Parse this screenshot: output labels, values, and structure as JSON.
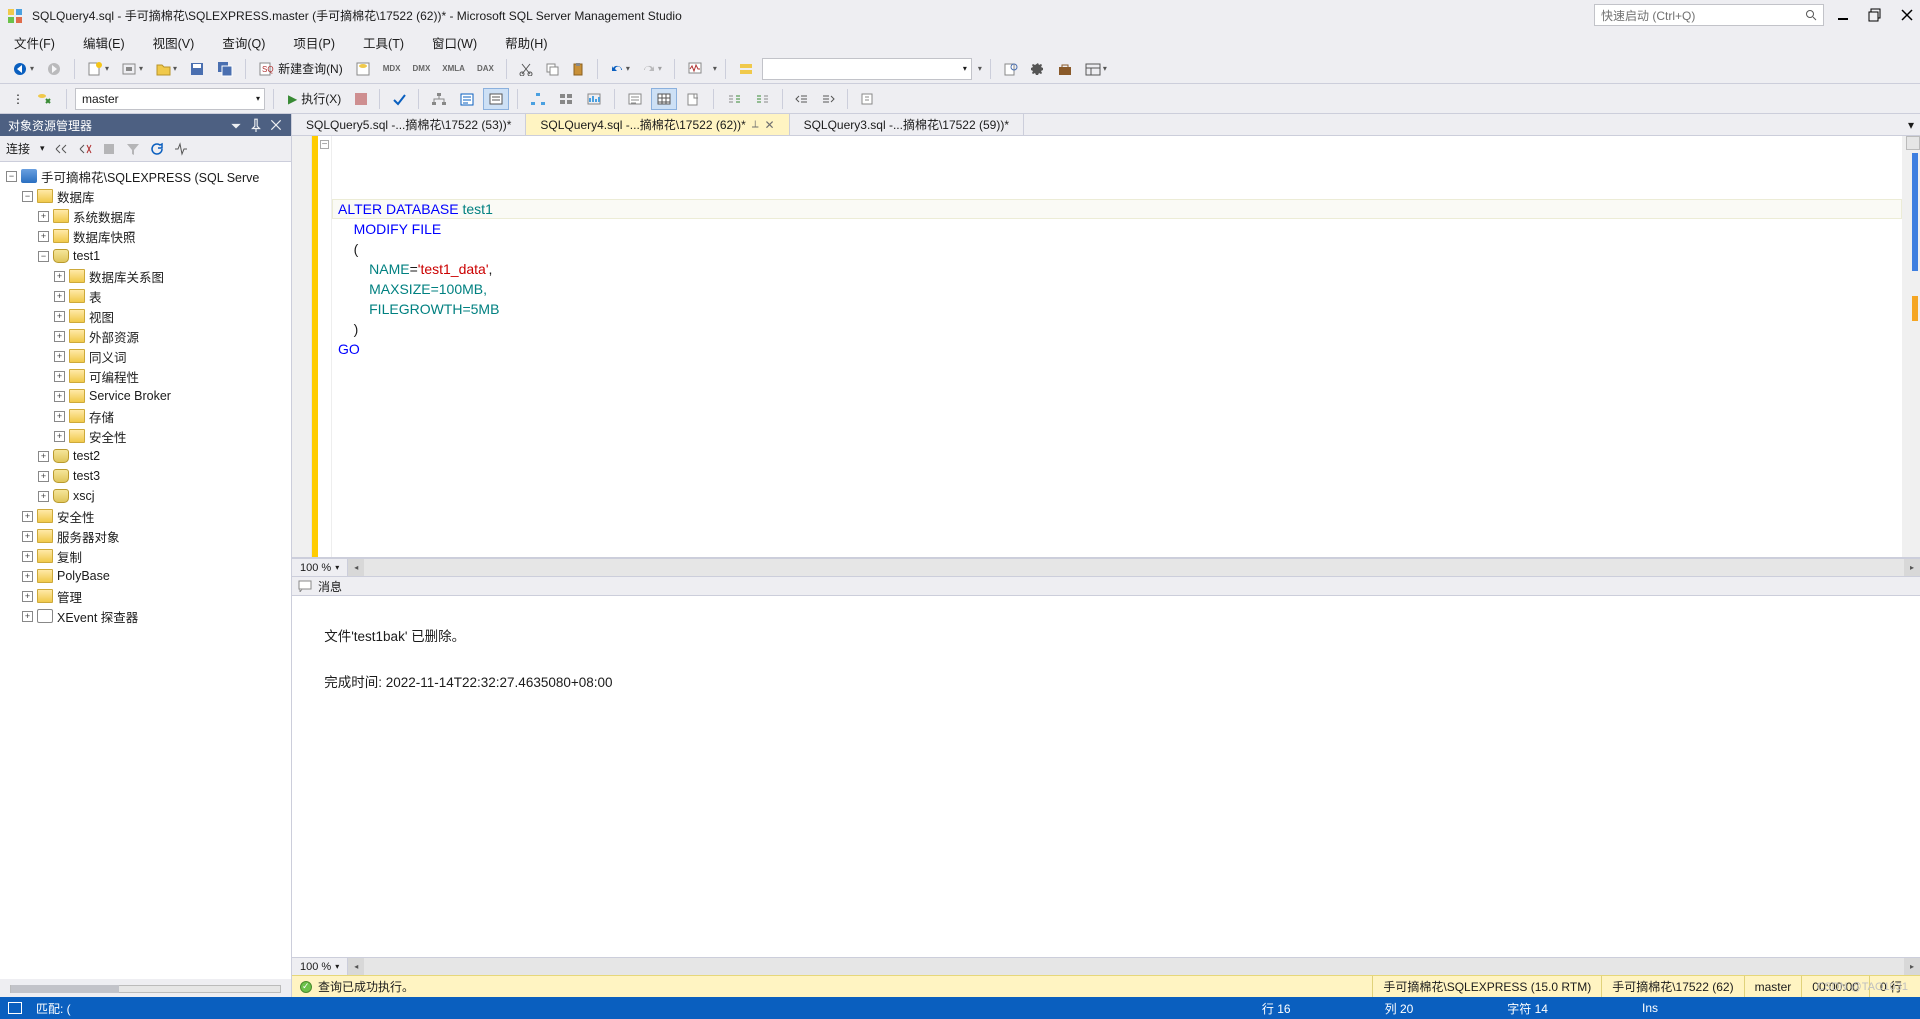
{
  "title": "SQLQuery4.sql - 手可摘棉花\\SQLEXPRESS.master (手可摘棉花\\17522 (62))* - Microsoft SQL Server Management Studio",
  "quick_launch": {
    "placeholder": "快速启动 (Ctrl+Q)"
  },
  "menu": [
    "文件(F)",
    "编辑(E)",
    "视图(V)",
    "查询(Q)",
    "项目(P)",
    "工具(T)",
    "窗口(W)",
    "帮助(H)"
  ],
  "toolbar1": {
    "new_query": "新建查询(N)",
    "xmla_labels": [
      "MDX",
      "DMX",
      "XMLA",
      "DAX"
    ]
  },
  "toolbar2": {
    "db_combo": "master",
    "execute": "执行(X)"
  },
  "object_explorer": {
    "title": "对象资源管理器",
    "connect_label": "连接",
    "root": "手可摘棉花\\SQLEXPRESS (SQL Serve",
    "nodes": [
      {
        "label": "数据库",
        "exp": true,
        "depth": 1,
        "icon": "folder",
        "children": [
          {
            "label": "系统数据库",
            "depth": 2,
            "icon": "folder"
          },
          {
            "label": "数据库快照",
            "depth": 2,
            "icon": "folder"
          },
          {
            "label": "test1",
            "exp": true,
            "depth": 2,
            "icon": "db",
            "children": [
              {
                "label": "数据库关系图",
                "depth": 3,
                "icon": "folder"
              },
              {
                "label": "表",
                "depth": 3,
                "icon": "folder"
              },
              {
                "label": "视图",
                "depth": 3,
                "icon": "folder"
              },
              {
                "label": "外部资源",
                "depth": 3,
                "icon": "folder"
              },
              {
                "label": "同义词",
                "depth": 3,
                "icon": "folder"
              },
              {
                "label": "可编程性",
                "depth": 3,
                "icon": "folder"
              },
              {
                "label": "Service Broker",
                "depth": 3,
                "icon": "folder"
              },
              {
                "label": "存储",
                "depth": 3,
                "icon": "folder"
              },
              {
                "label": "安全性",
                "depth": 3,
                "icon": "folder"
              }
            ]
          },
          {
            "label": "test2",
            "depth": 2,
            "icon": "db"
          },
          {
            "label": "test3",
            "depth": 2,
            "icon": "db"
          },
          {
            "label": "xscj",
            "depth": 2,
            "icon": "db"
          }
        ]
      },
      {
        "label": "安全性",
        "depth": 1,
        "icon": "folder"
      },
      {
        "label": "服务器对象",
        "depth": 1,
        "icon": "folder"
      },
      {
        "label": "复制",
        "depth": 1,
        "icon": "folder"
      },
      {
        "label": "PolyBase",
        "depth": 1,
        "icon": "folder"
      },
      {
        "label": "管理",
        "depth": 1,
        "icon": "folder"
      },
      {
        "label": "XEvent 探查器",
        "depth": 1,
        "icon": "xe"
      }
    ]
  },
  "tabs": [
    {
      "label": "SQLQuery5.sql -...摘棉花\\17522 (53))*",
      "active": false
    },
    {
      "label": "SQLQuery4.sql -...摘棉花\\17522 (62))*",
      "active": true
    },
    {
      "label": "SQLQuery3.sql -...摘棉花\\17522 (59))*",
      "active": false
    }
  ],
  "code": {
    "l1a": "ALTER",
    "l1b": "DATABASE",
    "l1c": "test1",
    "l2": "MODIFY FILE",
    "l3": "(",
    "l4a": "NAME",
    "l4b": "=",
    "l4c": "'test1_data'",
    "l4d": ",",
    "l5": "MAXSIZE=100MB,",
    "l6": "FILEGROWTH=5MB",
    "l7": ")",
    "l8": "GO"
  },
  "zoom": "100 %",
  "messages": {
    "header": "消息",
    "line1": "文件'test1bak' 已删除。",
    "line2": "完成时间: 2022-11-14T22:32:27.4635080+08:00"
  },
  "exec_status": {
    "text": "查询已成功执行。",
    "server": "手可摘棉花\\SQLEXPRESS (15.0 RTM)",
    "user": "手可摘棉花\\17522 (62)",
    "db": "master",
    "time": "00:00:00",
    "rows": "0 行"
  },
  "app_status": {
    "match": "匹配: (",
    "line": "行 16",
    "col": "列 20",
    "char": "字符 14",
    "ins": "Ins"
  },
  "watermark": "CSDN @TAO1031"
}
